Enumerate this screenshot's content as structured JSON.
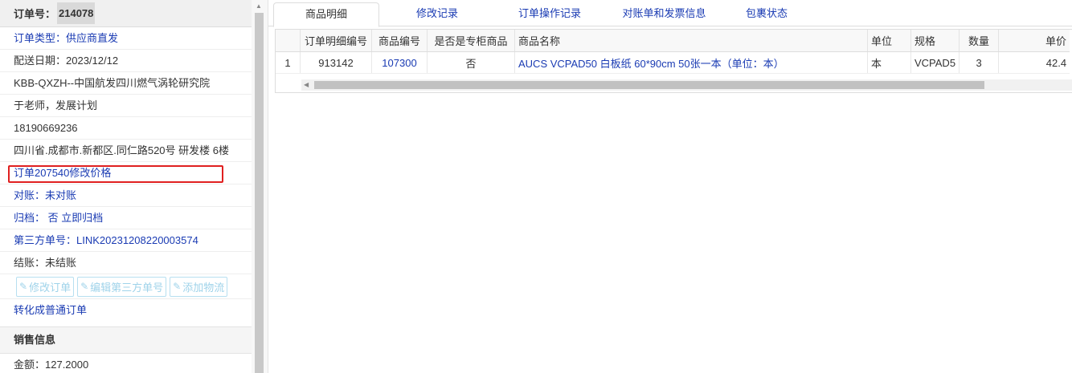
{
  "order": {
    "label": "订单号：",
    "number": "214078"
  },
  "info_rows": [
    {
      "text": "订单类型：供应商直发",
      "style": "blue"
    },
    {
      "text": "配送日期：2023/12/12",
      "style": "dark"
    },
    {
      "text": "KBB-QXZH--中国航发四川燃气涡轮研究院",
      "style": "dark"
    },
    {
      "text": "于老师，发展计划",
      "style": "dark"
    },
    {
      "text": "18190669236",
      "style": "dark"
    },
    {
      "text": "四川省.成都市.新都区.同仁路520号 研发楼 6楼",
      "style": "dark"
    },
    {
      "text": "订单207540修改价格",
      "style": "blue"
    },
    {
      "text": "对账：未对账",
      "style": "blue"
    },
    {
      "text": "归档： 否 立即归档",
      "style": "blue"
    },
    {
      "text": "第三方单号：LINK20231208220003574",
      "style": "blue"
    },
    {
      "text": "结账：未结账",
      "style": "dark"
    }
  ],
  "buttons": {
    "edit_order": "修改订单",
    "edit_third_party": "编辑第三方单号",
    "add_logistics": "添加物流"
  },
  "convert_link": "转化成普通订单",
  "sales_section": "销售信息",
  "amount": "金额：127.2000",
  "tabs": [
    "商品明细",
    "修改记录",
    "订单操作记录",
    "对账单和发票信息",
    "包裹状态"
  ],
  "table": {
    "headers": [
      "",
      "订单明细编号",
      "商品编号",
      "是否是专柜商品",
      "商品名称",
      "单位",
      "规格",
      "数量",
      "单价"
    ],
    "rows": [
      [
        "1",
        "913142",
        "107300",
        "否",
        "AUCS VCPAD50 白板纸 60*90cm 50张一本（单位：本）",
        "本",
        "VCPAD5",
        "3",
        "42.4"
      ]
    ]
  },
  "colors": {
    "link": "#1a3bb3",
    "highlight": "#e02020"
  }
}
